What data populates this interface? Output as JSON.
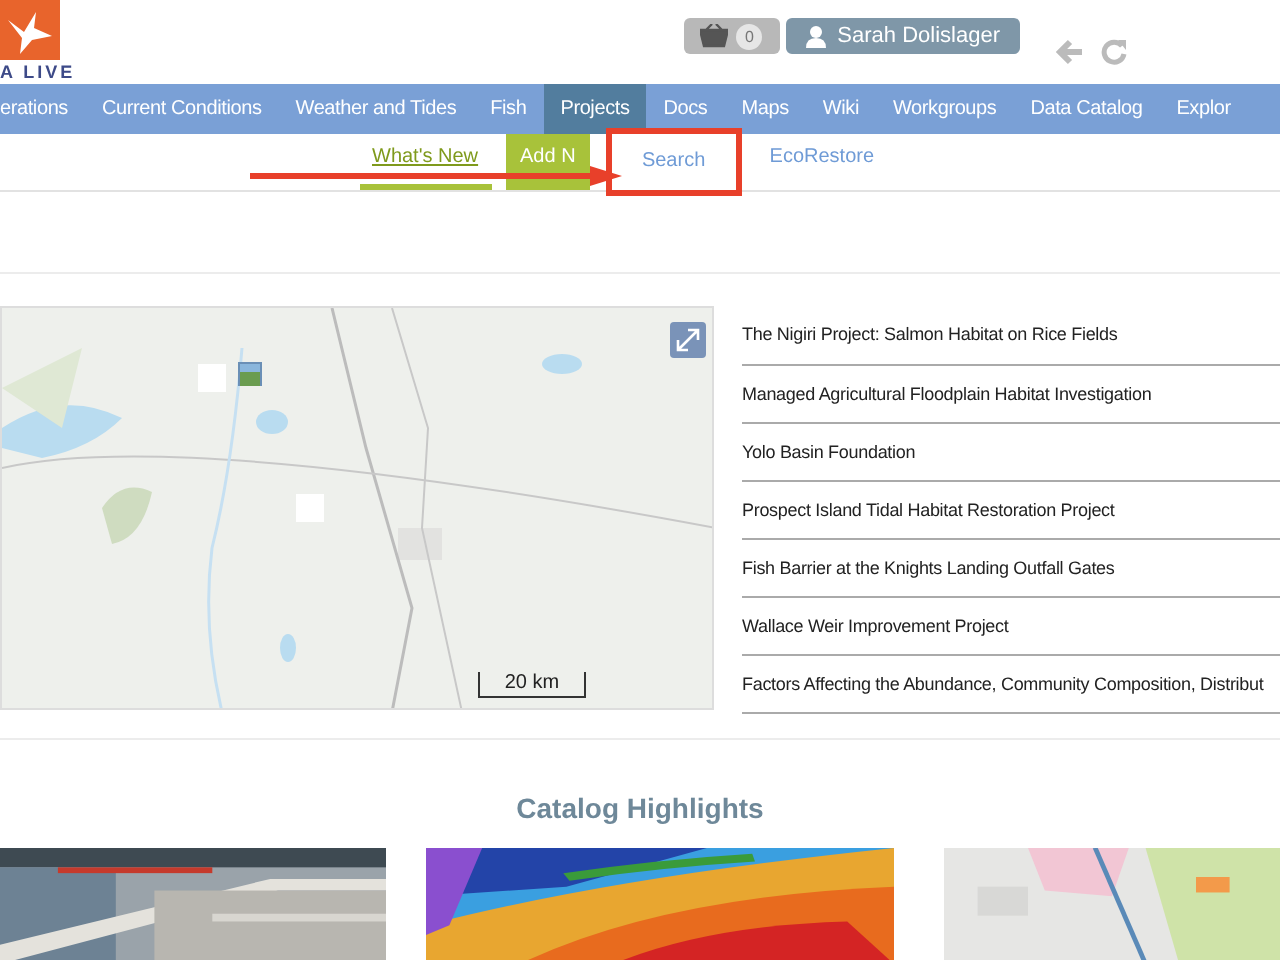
{
  "logo": {
    "text": "A LIVE"
  },
  "header": {
    "cart_count": "0",
    "user": "Sarah Dolislager"
  },
  "nav": [
    {
      "label": "erations",
      "selected": false
    },
    {
      "label": "Current Conditions",
      "selected": false
    },
    {
      "label": "Weather and Tides",
      "selected": false
    },
    {
      "label": "Fish",
      "selected": false
    },
    {
      "label": "Projects",
      "selected": true
    },
    {
      "label": "Docs",
      "selected": false
    },
    {
      "label": "Maps",
      "selected": false
    },
    {
      "label": "Wiki",
      "selected": false
    },
    {
      "label": "Workgroups",
      "selected": false
    },
    {
      "label": "Data Catalog",
      "selected": false
    },
    {
      "label": "Explor",
      "selected": false
    }
  ],
  "subnav": [
    {
      "label": "What's New",
      "kind": "underlined",
      "highlighted": false
    },
    {
      "label": "Add N",
      "kind": "filled",
      "highlighted": false
    },
    {
      "label": "Search",
      "kind": "plain",
      "highlighted": true
    },
    {
      "label": "EcoRestore",
      "kind": "plain",
      "highlighted": false
    }
  ],
  "map": {
    "scale": "20 km"
  },
  "projects": [
    "The Nigiri Project: Salmon Habitat on Rice Fields",
    "Managed Agricultural Floodplain Habitat Investigation",
    "Yolo Basin Foundation",
    "Prospect Island Tidal Habitat Restoration Project",
    "Fish Barrier at the Knights Landing Outfall Gates",
    "Wallace Weir Improvement Project",
    "Factors Affecting the Abundance, Community Composition, Distribut"
  ],
  "catalog": {
    "title": "Catalog Highlights"
  }
}
